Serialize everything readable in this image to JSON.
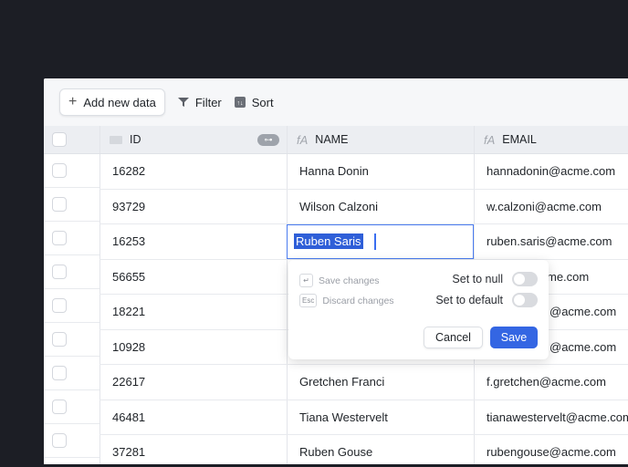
{
  "toolbar": {
    "add_label": "Add new data",
    "filter_label": "Filter",
    "sort_label": "Sort"
  },
  "columns": [
    {
      "label": "ID",
      "icon": "number-field-icon",
      "badge": "key-icon"
    },
    {
      "label": "NAME",
      "icon": "text-field-icon"
    },
    {
      "label": "EMAIL",
      "icon": "text-field-icon"
    }
  ],
  "rows": [
    {
      "id": "16282",
      "name": "Hanna Donin",
      "email": "hannadonin@acme.com"
    },
    {
      "id": "93729",
      "name": "Wilson Calzoni",
      "email": "w.calzoni@acme.com"
    },
    {
      "id": "16253",
      "name": "Ruben Saris",
      "email": "ruben.saris@acme.com"
    },
    {
      "id": "56655",
      "name": "",
      "email": "me.com"
    },
    {
      "id": "18221",
      "name": "",
      "email": "@acme.com"
    },
    {
      "id": "10928",
      "name": "",
      "email": "@acme.com"
    },
    {
      "id": "22617",
      "name": "Gretchen Franci",
      "email": "f.gretchen@acme.com"
    },
    {
      "id": "46481",
      "name": "Tiana Westervelt",
      "email": "tianawestervelt@acme.com"
    },
    {
      "id": "37281",
      "name": "Ruben Gouse",
      "email": "rubengouse@acme.com"
    }
  ],
  "editor": {
    "save_hint": "Save changes",
    "save_key": "↵",
    "discard_hint": "Discard changes",
    "discard_key": "Esc",
    "set_null": "Set to null",
    "set_null_on": false,
    "set_default": "Set to default",
    "set_default_on": false,
    "cancel": "Cancel",
    "save": "Save"
  },
  "colors": {
    "accent": "#3466e3",
    "background": "#1c1e25"
  }
}
